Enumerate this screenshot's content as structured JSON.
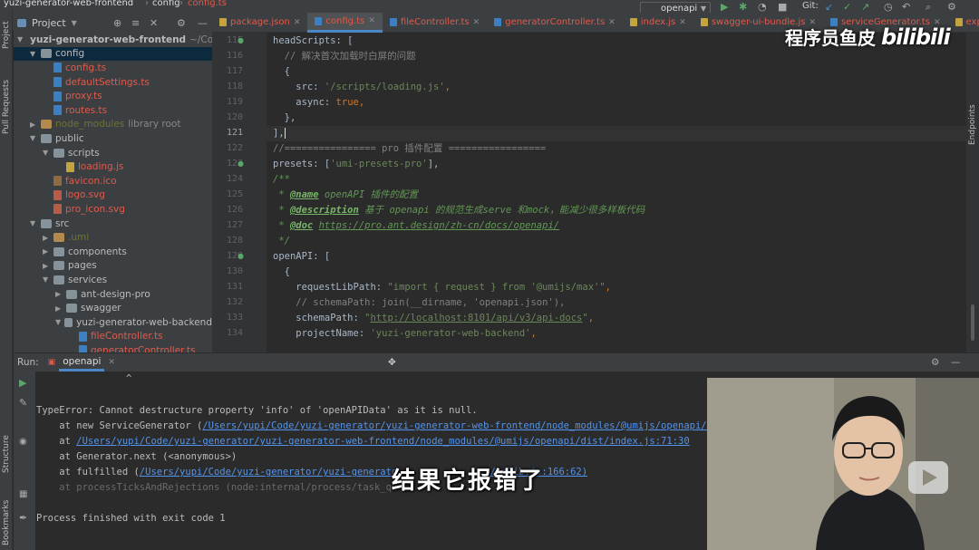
{
  "breadcrumb": {
    "project": "yuzi-generator-web-frontend",
    "folder": "config",
    "file": "config.ts"
  },
  "run_config": "openapi",
  "git_label": "Git:",
  "project_panel": {
    "title": "Project",
    "tree": [
      {
        "label": "yuzi-generator-web-frontend",
        "suffix": "~/Co",
        "depth": 0,
        "open": true,
        "type": "folder",
        "bold": true
      },
      {
        "label": "config",
        "depth": 1,
        "open": true,
        "type": "folder",
        "selected": true
      },
      {
        "label": "config.ts",
        "depth": 2,
        "type": "ts"
      },
      {
        "label": "defaultSettings.ts",
        "depth": 2,
        "type": "ts"
      },
      {
        "label": "proxy.ts",
        "depth": 2,
        "type": "ts"
      },
      {
        "label": "routes.ts",
        "depth": 2,
        "type": "ts"
      },
      {
        "label": "node_modules",
        "suffix": "library root",
        "depth": 1,
        "open": false,
        "type": "folder-orange"
      },
      {
        "label": "public",
        "depth": 1,
        "open": true,
        "type": "folder"
      },
      {
        "label": "scripts",
        "depth": 2,
        "open": true,
        "type": "folder"
      },
      {
        "label": "loading.js",
        "depth": 3,
        "type": "js"
      },
      {
        "label": "favicon.ico",
        "depth": 2,
        "type": "ico"
      },
      {
        "label": "logo.svg",
        "depth": 2,
        "type": "svg"
      },
      {
        "label": "pro_icon.svg",
        "depth": 2,
        "type": "svg"
      },
      {
        "label": "src",
        "depth": 1,
        "open": true,
        "type": "folder"
      },
      {
        "label": ".umi",
        "depth": 2,
        "open": false,
        "type": "folder-olive"
      },
      {
        "label": "components",
        "depth": 2,
        "open": false,
        "type": "folder"
      },
      {
        "label": "pages",
        "depth": 2,
        "open": false,
        "type": "folder"
      },
      {
        "label": "services",
        "depth": 2,
        "open": true,
        "type": "folder"
      },
      {
        "label": "ant-design-pro",
        "depth": 3,
        "open": false,
        "type": "folder"
      },
      {
        "label": "swagger",
        "depth": 3,
        "open": false,
        "type": "folder"
      },
      {
        "label": "yuzi-generator-web-backend",
        "depth": 3,
        "open": true,
        "type": "folder"
      },
      {
        "label": "fileController.ts",
        "depth": 4,
        "type": "ts"
      },
      {
        "label": "generatorController.ts",
        "depth": 4,
        "type": "ts"
      }
    ]
  },
  "tabs": [
    {
      "label": "package.json",
      "active": false
    },
    {
      "label": "config.ts",
      "active": true
    },
    {
      "label": "fileController.ts",
      "active": false
    },
    {
      "label": "generatorController.ts",
      "active": false
    },
    {
      "label": "index.js",
      "active": false
    },
    {
      "label": "swagger-ui-bundle.js",
      "active": false
    },
    {
      "label": "serviceGenerator.ts",
      "active": false
    },
    {
      "label": "exp",
      "active": false
    }
  ],
  "editor": {
    "line_numbers": [
      "115",
      "116",
      "117",
      "118",
      "119",
      "120",
      "121",
      "122",
      "123",
      "124",
      "125",
      "126",
      "127",
      "128",
      "129",
      "130",
      "131",
      "132",
      "133",
      "134"
    ],
    "current_line": "121"
  },
  "run_panel": {
    "label": "Run:",
    "tab": "openapi",
    "caret": "^",
    "error": "TypeError: Cannot destructure property 'info' of 'openAPIData' as it is null.",
    "stack": [
      {
        "prefix": "    at new ServiceGenerator (",
        "link": "/Users/yupi/Code/yuzi-generator/yuzi-generator-web-frontend/node_modules/@umijs/openapi/d"
      },
      {
        "prefix": "    at ",
        "link": "/Users/yupi/Code/yuzi-generator/yuzi-generator-web-frontend/node_modules/@umijs/openapi/dist/index.js:71:30"
      },
      {
        "prefix": "    at Generator.next (<anonymous>)",
        "link": ""
      },
      {
        "prefix": "    at fulfilled (",
        "link": "/Users/yupi/Code/yuzi-generator/yuzi-generato",
        "tail": "s/tslib.js:166:62)"
      }
    ],
    "dim_line": "    at processTicksAndRejections (node:internal/process/task_qu",
    "exit": "Process finished with exit code 1"
  },
  "side_labels": {
    "project": "Project",
    "pull_requests": "Pull Requests",
    "structure": "Structure",
    "bookmarks": "Bookmarks",
    "endpoints": "Endpoints"
  },
  "subtitle": "结果它报错了",
  "watermark": {
    "name": "程序员鱼皮",
    "brand": "bilibili"
  }
}
